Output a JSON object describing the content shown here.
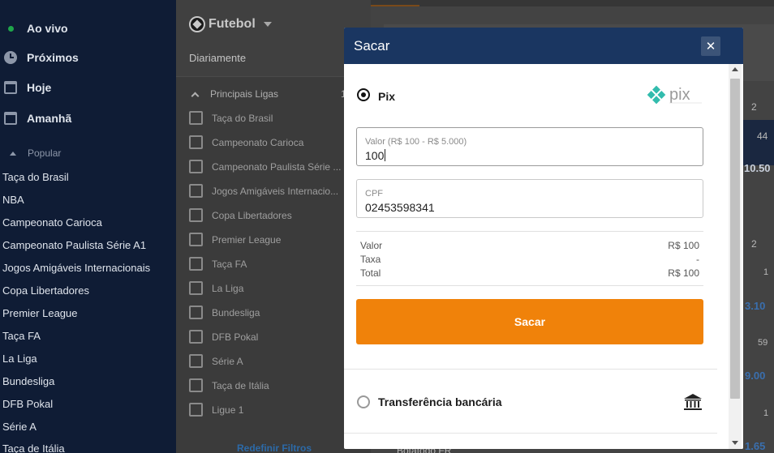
{
  "sidebar": {
    "nav": [
      {
        "label": "Ao vivo",
        "icon": "live-dot-icon"
      },
      {
        "label": "Próximos",
        "icon": "clock-icon"
      },
      {
        "label": "Hoje",
        "icon": "calendar-icon"
      },
      {
        "label": "Amanhã",
        "icon": "calendar-icon"
      }
    ],
    "popular_label": "Popular",
    "leagues": [
      "Taça do Brasil",
      "NBA",
      "Campeonato Carioca",
      "Campeonato Paulista Série A1",
      "Jogos Amigáveis Internacionais",
      "Copa Libertadores",
      "Premier League",
      "Taça FA",
      "La Liga",
      "Bundesliga",
      "DFB Pokal",
      "Série A",
      "Taça de Itália"
    ]
  },
  "filter": {
    "sport": "Futebol",
    "period": "Diariamente",
    "leagues_header": "Principais Ligas",
    "leagues_count": "1",
    "leagues": [
      "Taça do Brasil",
      "Campeonato Carioca",
      "Campeonato Paulista Série ...",
      "Jogos Amigáveis Internacio...",
      "Copa Libertadores",
      "Premier League",
      "Taça FA",
      "La Liga",
      "Bundesliga",
      "DFB Pokal",
      "Série A",
      "Taça de Itália",
      "Ligue 1"
    ],
    "reset_label": "Redefinir Filtros"
  },
  "content": {
    "col_a": "2",
    "odd_a": "44",
    "odd_b": "10.50",
    "col_b": "2",
    "val_1": "1",
    "odd_c": "3.10",
    "val_2": "59",
    "odd_d": "9.00",
    "val_3": "1",
    "odd_e": "1.65",
    "team": "Botafogo FR"
  },
  "modal": {
    "title": "Sacar",
    "close_glyph": "✕",
    "pix_option": "Pix",
    "pix_logo_text": "pix",
    "amount_label": "Valor (R$ 100 - R$ 5.000)",
    "amount_value": "100",
    "cpf_label": "CPF",
    "cpf_value": "02453598341",
    "summary": [
      {
        "label": "Valor",
        "value": "R$ 100"
      },
      {
        "label": "Taxa",
        "value": "-"
      },
      {
        "label": "Total",
        "value": "R$ 100"
      }
    ],
    "submit_label": "Sacar",
    "bank_option": "Transferência bancária",
    "accent_color": "#f0820a",
    "header_color": "#1a3661"
  }
}
